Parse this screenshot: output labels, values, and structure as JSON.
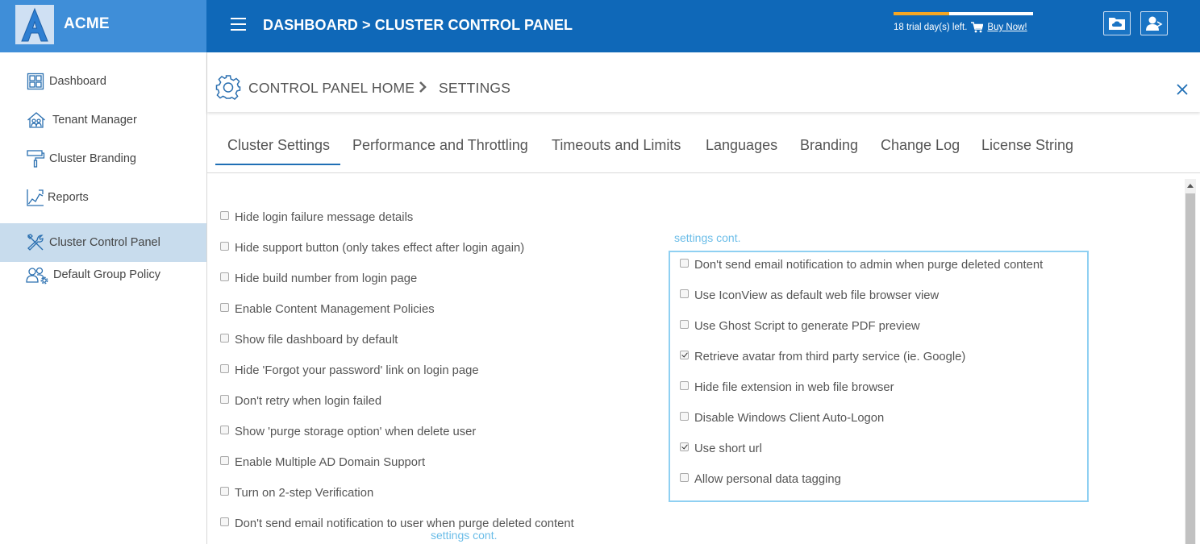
{
  "brand": {
    "name": "ACME",
    "logo_letter": "A"
  },
  "header": {
    "breadcrumb": "DASHBOARD > CLUSTER CONTROL PANEL",
    "trial_text": "18 trial day(s) left.",
    "buy_label": "Buy Now!",
    "trial_progress_fraction": 0.4,
    "accent_color": "#f5a623",
    "bar_color": "#0f68b8",
    "icons": [
      "menu-icon",
      "cart-icon",
      "cloud-folder-icon",
      "user-logout-icon"
    ]
  },
  "sidebar": {
    "items": [
      {
        "label": "Dashboard",
        "icon": "dashboard-grid-icon",
        "active": false
      },
      {
        "label": "Tenant Manager",
        "icon": "house-users-icon",
        "active": false
      },
      {
        "label": "Cluster Branding",
        "icon": "paint-roller-icon",
        "active": false
      },
      {
        "label": "Reports",
        "icon": "line-chart-icon",
        "active": false
      },
      {
        "label": "Cluster Control Panel",
        "icon": "tools-icon",
        "active": true
      },
      {
        "label": "Default Group Policy",
        "icon": "users-gear-icon",
        "active": false
      }
    ]
  },
  "panel": {
    "home_label": "CONTROL PANEL HOME",
    "settings_label": "SETTINGS",
    "icons": [
      "gear-icon",
      "chevron-right-icon",
      "close-icon"
    ]
  },
  "tabs": [
    {
      "label": "Cluster Settings",
      "active": true
    },
    {
      "label": "Performance and Throttling",
      "active": false
    },
    {
      "label": "Timeouts and Limits",
      "active": false
    },
    {
      "label": "Languages",
      "active": false
    },
    {
      "label": "Branding",
      "active": false
    },
    {
      "label": "Change Log",
      "active": false
    },
    {
      "label": "License String",
      "active": false
    }
  ],
  "settings_left": [
    {
      "label": "Hide login failure message details",
      "checked": false
    },
    {
      "label": "Hide support button (only takes effect after login again)",
      "checked": false
    },
    {
      "label": "Hide build number from login page",
      "checked": false
    },
    {
      "label": "Enable Content Management Policies",
      "checked": false
    },
    {
      "label": "Show file dashboard by default",
      "checked": false
    },
    {
      "label": "Hide 'Forgot your password' link on login page",
      "checked": false
    },
    {
      "label": "Don't retry when login failed",
      "checked": false
    },
    {
      "label": "Show 'purge storage option' when delete user",
      "checked": false
    },
    {
      "label": "Enable Multiple AD Domain Support",
      "checked": false
    },
    {
      "label": "Turn on 2-step Verification",
      "checked": false
    },
    {
      "label": "Don't send email notification to user when purge deleted content",
      "checked": false
    }
  ],
  "settings_right": [
    {
      "label": "Don't send email notification to admin when purge deleted content",
      "checked": false
    },
    {
      "label": "Use IconView as default web file browser view",
      "checked": false
    },
    {
      "label": "Use Ghost Script to generate PDF preview",
      "checked": false
    },
    {
      "label": "Retrieve avatar from third party service (ie. Google)",
      "checked": true
    },
    {
      "label": "Hide file extension in web file browser",
      "checked": false
    },
    {
      "label": "Disable Windows Client Auto-Logon",
      "checked": false
    },
    {
      "label": "Use short url",
      "checked": true
    },
    {
      "label": "Allow personal data tagging",
      "checked": false
    }
  ],
  "annotations": {
    "cont_label_top": "settings cont.",
    "cont_label_bottom": "settings cont.",
    "highlight_color": "#8fd0f2"
  }
}
